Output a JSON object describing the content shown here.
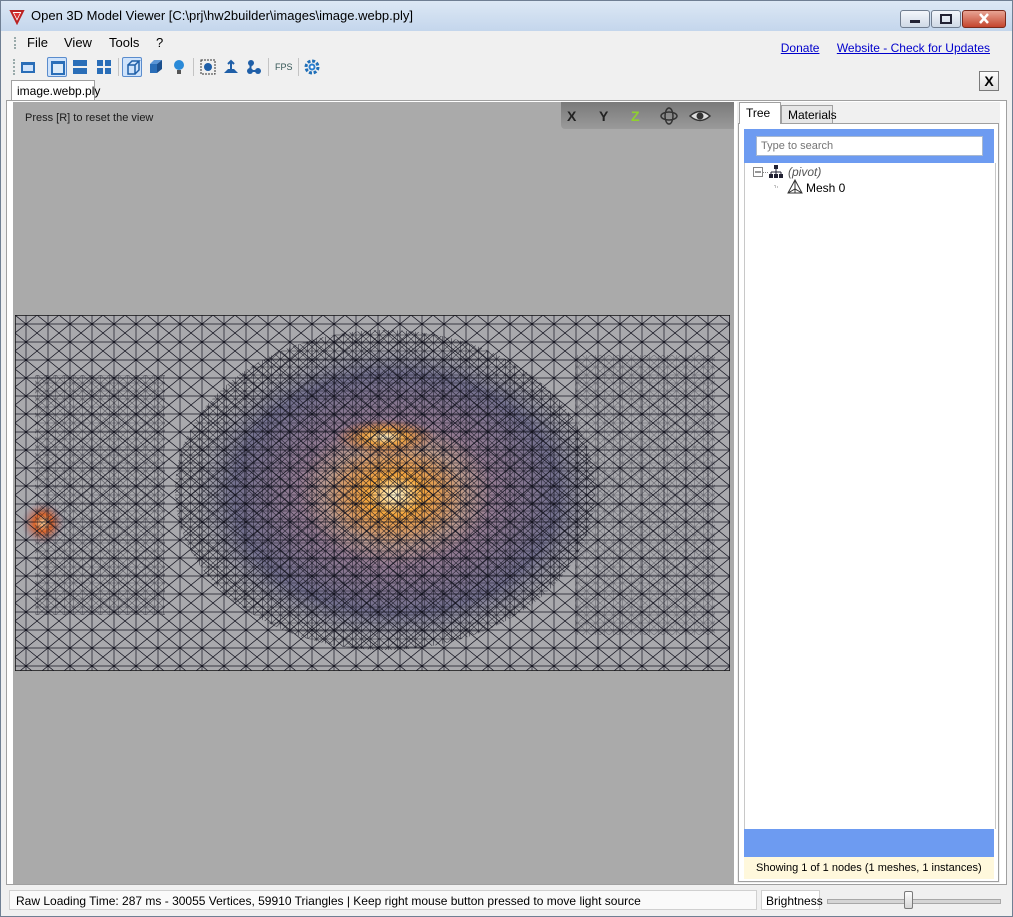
{
  "window": {
    "title": "Open 3D Model Viewer  [C:\\prj\\hw2builder\\images\\image.webp.ply]"
  },
  "menu": {
    "items": [
      "File",
      "View",
      "Tools",
      "?"
    ]
  },
  "links": {
    "donate": "Donate",
    "website": "Website - Check for Updates"
  },
  "toolbar": {
    "fps_label": "FPS"
  },
  "document": {
    "tab_label": "image.webp.ply",
    "close_label": "X"
  },
  "viewport": {
    "hint": "Press [R] to reset the view",
    "axes": [
      "X",
      "Y",
      "Z"
    ],
    "axis_colors": [
      "#222222",
      "#222222",
      "#8fd12e"
    ]
  },
  "panel": {
    "tabs": [
      "Tree",
      "Materials"
    ],
    "search_placeholder": "Type to search",
    "tree": {
      "root": "(pivot)",
      "child": "Mesh 0"
    },
    "status": "Showing 1 of 1 nodes (1 meshes, 1 instances)"
  },
  "statusbar": {
    "text": "Raw Loading Time: 287 ms - 30055 Vertices, 59910 Triangles  | Keep right mouse button pressed to move light source",
    "brightness_label": "Brightness",
    "brightness_level": 0.47
  }
}
